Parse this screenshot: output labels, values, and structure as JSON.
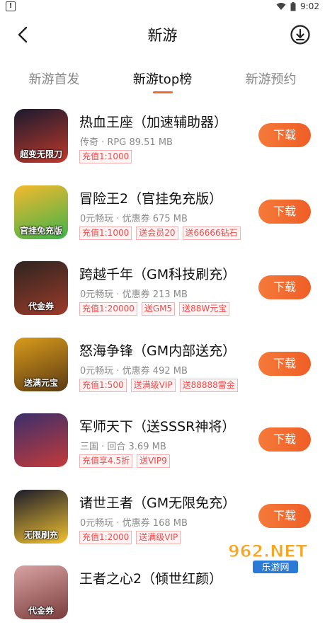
{
  "status_bar": {
    "time": "9:02",
    "warning_icon": "warning-icon",
    "wifi_icon": "wifi-icon",
    "battery_icon": "battery-icon"
  },
  "header": {
    "title": "新游"
  },
  "tabs": [
    {
      "label": "新游首发",
      "active": false
    },
    {
      "label": "新游top榜",
      "active": true
    },
    {
      "label": "新游预约",
      "active": false
    }
  ],
  "games": [
    {
      "name": "热血王座（加速辅助器）",
      "meta": "传奇 · RPG   89.51 MB",
      "tags": [
        "充值1:1000"
      ],
      "button": "下载",
      "icon_text": "超变无限刀",
      "icon_colors": [
        "#1a1a2e",
        "#c0392b"
      ]
    },
    {
      "name": "冒险王2（官挂免充版）",
      "meta": "0元畅玩 · 优惠券   675 MB",
      "tags": [
        "充值1:1000",
        "送会员20",
        "送66666钻石"
      ],
      "button": "下载",
      "icon_text": "官挂免充版",
      "icon_colors": [
        "#f5b82e",
        "#3db34a"
      ]
    },
    {
      "name": "跨越千年（GM科技刷充）",
      "meta": "0元畅玩 · 优惠券   213 MB",
      "tags": [
        "充值1:20000",
        "送GM5",
        "送88W元宝"
      ],
      "button": "下载",
      "icon_text": "代金券",
      "icon_colors": [
        "#2d2420",
        "#9c3b2a"
      ]
    },
    {
      "name": "怒海争锋（GM内部送充）",
      "meta": "0元畅玩 · 优惠券   492 MB",
      "tags": [
        "充值1:500",
        "送满级VIP",
        "送88888雷金"
      ],
      "button": "下载",
      "icon_text": "送满元宝",
      "icon_colors": [
        "#d99b1c",
        "#5a3a12"
      ]
    },
    {
      "name": "军师天下（送SSSR神将）",
      "meta": "三国 · 回合   3.69 MB",
      "tags": [
        "充值享4.5折",
        "送VIP9"
      ],
      "button": "下载",
      "icon_text": "",
      "icon_colors": [
        "#3a2f6b",
        "#c43a3a"
      ]
    },
    {
      "name": "诸世王者（GM无限免充）",
      "meta": "0元畅玩 · 优惠券   168 MB",
      "tags": [
        "充值1:2000",
        "送满级VIP"
      ],
      "button": "下载",
      "icon_text": "无限刷充",
      "icon_colors": [
        "#1b1b2a",
        "#f2c230"
      ]
    },
    {
      "name": "王者之心2（倾世红颜）",
      "meta": "",
      "tags": [],
      "button": "",
      "icon_text": "代金券",
      "icon_colors": [
        "#d9a3a3",
        "#7a3c3c"
      ]
    }
  ],
  "watermark": {
    "text_big": "962.NET",
    "text_small": "乐游网"
  }
}
